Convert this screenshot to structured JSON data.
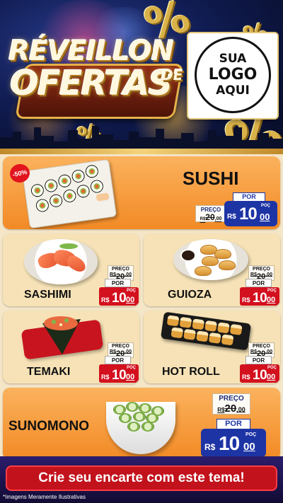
{
  "header": {
    "title_line1": "RÉVEILLON",
    "title_line2": "OFERTAS",
    "title_de": "DE",
    "logo": [
      "SUA",
      "LOGO",
      "AQUI"
    ]
  },
  "price_labels": {
    "old": "PREÇO",
    "new": "POR",
    "currency": "R$",
    "unit": "POÇ"
  },
  "products": {
    "sushi": {
      "name": "SUSHI",
      "badge": "-50%",
      "old_int": "20",
      "old_cents": "00",
      "new_int": "10",
      "new_cents": "00"
    },
    "sashimi": {
      "name": "SASHIMI",
      "old_int": "20",
      "old_cents": "00",
      "new_int": "10",
      "new_cents": "00"
    },
    "guioza": {
      "name": "GUIOZA",
      "old_int": "20",
      "old_cents": "00",
      "new_int": "10",
      "new_cents": "00"
    },
    "temaki": {
      "name": "TEMAKI",
      "old_int": "20",
      "old_cents": "00",
      "new_int": "10",
      "new_cents": "00"
    },
    "hotroll": {
      "name": "HOT ROLL",
      "old_int": "20",
      "old_cents": "00",
      "new_int": "10",
      "new_cents": "00"
    },
    "sunomono": {
      "name": "SUNOMONO",
      "old_int": "20",
      "old_cents": "00",
      "new_int": "10",
      "new_cents": "00"
    }
  },
  "footer": {
    "cta": "Crie seu encarte com este tema!",
    "disclaimer": "*Imagens Meramente Ilustrativas"
  },
  "colors": {
    "orange_card": "#f28a25",
    "light_card": "#f6e2b6",
    "price_red": "#d3101e",
    "price_blue": "#1d34a5",
    "cta_red": "#c2121c"
  }
}
